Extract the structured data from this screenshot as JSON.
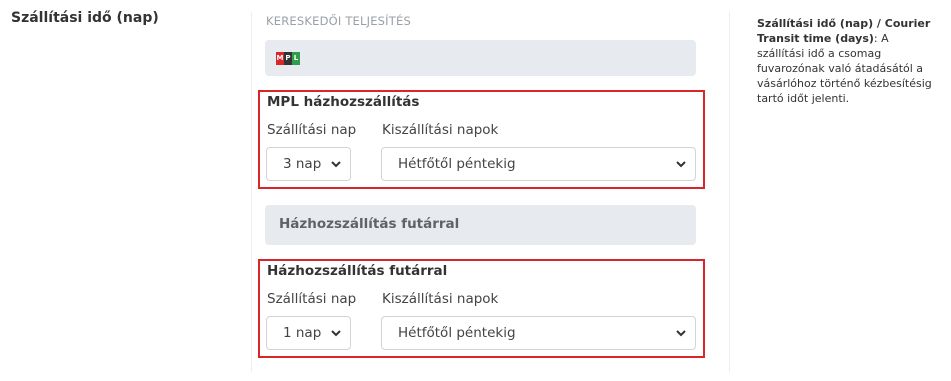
{
  "field": {
    "label": "Szállítási idő (nap)"
  },
  "panel": {
    "section_caption": "KERESKEDŐI TELJESÍTÉS",
    "mpl_logo": {
      "letters": [
        "M",
        "P",
        "L"
      ],
      "colors": [
        "#d9262b",
        "#333333",
        "#2e9e4a"
      ]
    },
    "mpl_box": {
      "title": "MPL házhozszállítás",
      "days_label": "Szállítási nap",
      "days_value": "3 nap",
      "shipping_label": "Kiszállítási napok",
      "shipping_value": "Hétfőtől péntekig"
    },
    "courier_bar": {
      "title": "Házhozszállítás futárral"
    },
    "courier_box": {
      "title": "Házhozszállítás futárral",
      "days_label": "Szállítási nap",
      "days_value": "1 nap",
      "shipping_label": "Kiszállítási napok",
      "shipping_value": "Hétfőtől péntekig"
    }
  },
  "help": {
    "title": "Szállítási idő (nap) / Courier Transit time (days)",
    "separator": ":",
    "body": " A szállítási idő a csomag fuvarozónak való átadásától a vásárlóhoz történő kézbesítésig tartó időt jelenti."
  },
  "colors": {
    "highlight_border": "#d9262b",
    "bar_background": "#e7eaee"
  },
  "icons": {
    "select_arrow": "chevron-down-icon"
  }
}
